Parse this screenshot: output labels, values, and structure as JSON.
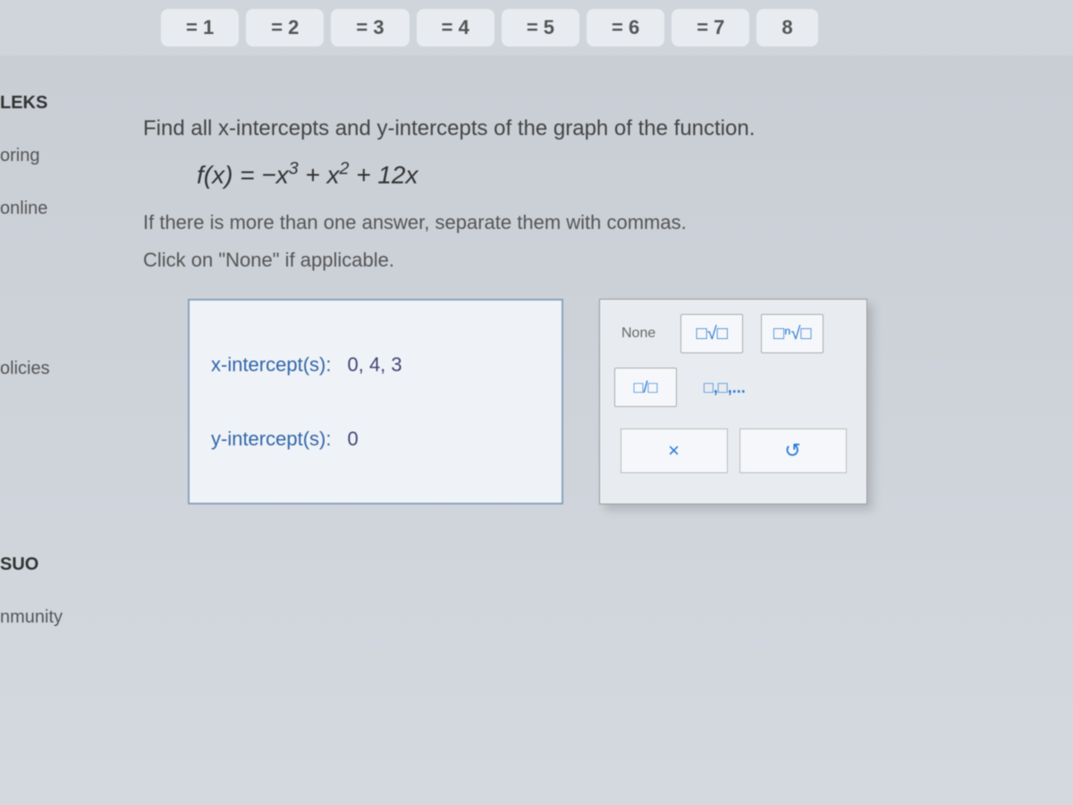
{
  "tabs": [
    "= 1",
    "= 2",
    "= 3",
    "= 4",
    "= 5",
    "= 6",
    "= 7",
    "8"
  ],
  "sidebar": {
    "items": [
      "LEKS",
      "oring",
      "online",
      "olicies",
      "SUO",
      "nmunity"
    ]
  },
  "question": {
    "prompt": "Find all x-intercepts and y-intercepts of the graph of the function.",
    "formula_text": "f(x) = −x³ + x² + 12x",
    "instruction1": "If there is more than one answer, separate them with commas.",
    "instruction2": "Click on \"None\" if applicable."
  },
  "answers": {
    "x_label": "x-intercept(s):",
    "x_value": "0, 4, 3",
    "y_label": "y-intercept(s):",
    "y_value": "0"
  },
  "toolbox": {
    "none": "None",
    "sqrt": "□√□",
    "nth": "□ⁿ√□",
    "frac": "□/□",
    "list": "□,□,...",
    "clear": "×",
    "reset": "↺"
  }
}
